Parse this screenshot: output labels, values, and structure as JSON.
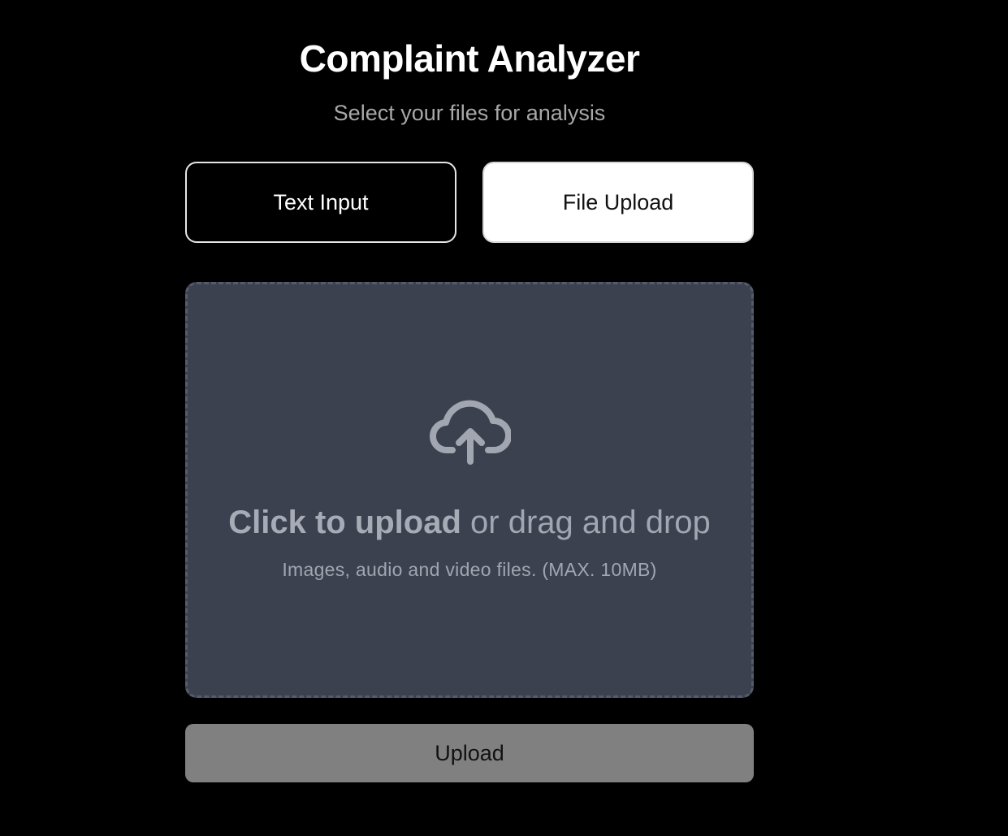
{
  "header": {
    "title": "Complaint Analyzer",
    "subtitle": "Select your files for analysis"
  },
  "mode_toggle": {
    "options": [
      {
        "label": "Text Input",
        "selected": false
      },
      {
        "label": "File Upload",
        "selected": true
      }
    ]
  },
  "dropzone": {
    "icon": "cloud-upload-icon",
    "primary_action": "Click to upload",
    "secondary_text": " or drag and drop",
    "hint": "Images, audio and video files. (MAX. 10MB)"
  },
  "actions": {
    "upload_label": "Upload"
  },
  "colors": {
    "background": "#000000",
    "dropzone_bg": "#3c4150",
    "upload_button_bg": "#808080",
    "selected_tab_bg": "#ffffff"
  }
}
